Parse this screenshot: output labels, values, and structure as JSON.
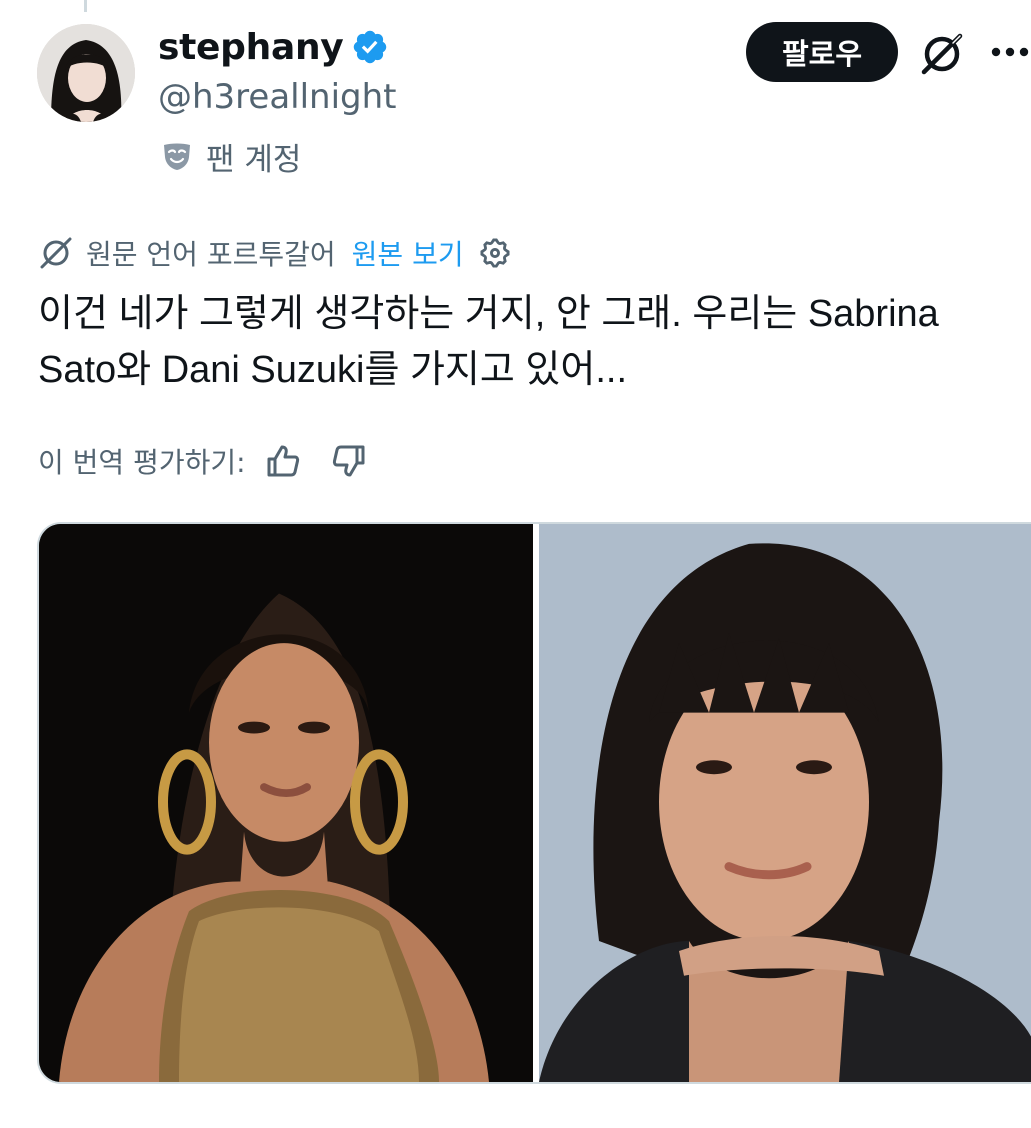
{
  "author": {
    "display_name": "stephany",
    "handle": "@h3reallnight",
    "account_label": "팬 계정",
    "avatar_icon": "profile-photo",
    "verified_icon": "verified-badge-icon",
    "account_type_icon": "mask-icon"
  },
  "actions": {
    "follow_label": "팔로우",
    "grok_icon": "grok-icon",
    "more_icon": "more-icon"
  },
  "translation": {
    "notice": "원문 언어 포르투갈어",
    "view_original": "원본 보기",
    "settings_icon": "gear-icon",
    "rate_label": "이 번역 평가하기:",
    "thumbs_up_icon": "thumbs-up-icon",
    "thumbs_down_icon": "thumbs-down-icon"
  },
  "tweet": {
    "text": "이건 네가 그렇게 생각하는 거지, 안 그래. 우리는 Sabrina Sato와 Dani Suzuki를 가지고 있어..."
  },
  "media": {
    "photos": [
      "photo-woman-gold-dress",
      "photo-woman-with-bangs"
    ]
  },
  "colors": {
    "text_primary": "#0f1419",
    "text_secondary": "#536471",
    "link": "#1d9bf0",
    "verified": "#1d9bf0",
    "border": "#cfd9de",
    "follow_bg": "#0f1419"
  }
}
